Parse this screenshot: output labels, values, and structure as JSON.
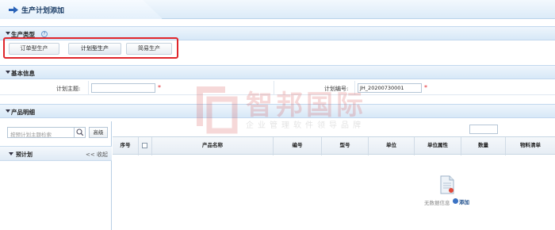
{
  "page": {
    "title": "生产计划添加"
  },
  "sections": {
    "production_type": {
      "label": "生产类型",
      "help": "?"
    },
    "basic_info": {
      "label": "基本信息"
    },
    "product_detail": {
      "label": "产品明细"
    }
  },
  "production_types": [
    {
      "label": "订单型生产",
      "selected": false
    },
    {
      "label": "计划型生产",
      "selected": true
    },
    {
      "label": "简易生产",
      "selected": false
    }
  ],
  "basic_info": {
    "plan_subject_label": "计划主题:",
    "plan_subject_value": "",
    "plan_number_label": "计划编号:",
    "plan_number_value": "JH_20200730001",
    "required_mark": "*"
  },
  "left_panel": {
    "search_placeholder": "按预计划主题检索",
    "advanced_label": "高级",
    "plan_group_label": "预计划",
    "collapse_label": "<< 收起"
  },
  "grid": {
    "columns": [
      "序号",
      "",
      "产品名称",
      "编号",
      "型号",
      "单位",
      "单位属性",
      "数量",
      "物料清单"
    ],
    "rows": [],
    "empty_text": "无数据信息",
    "add_label": "添加"
  },
  "watermark": {
    "brand": "智邦国际",
    "slogan": "企业管理软件领导品牌"
  },
  "colors": {
    "highlight_border": "#e0262b",
    "header_bg": "#dcebf8",
    "link": "#1f4f8c"
  }
}
